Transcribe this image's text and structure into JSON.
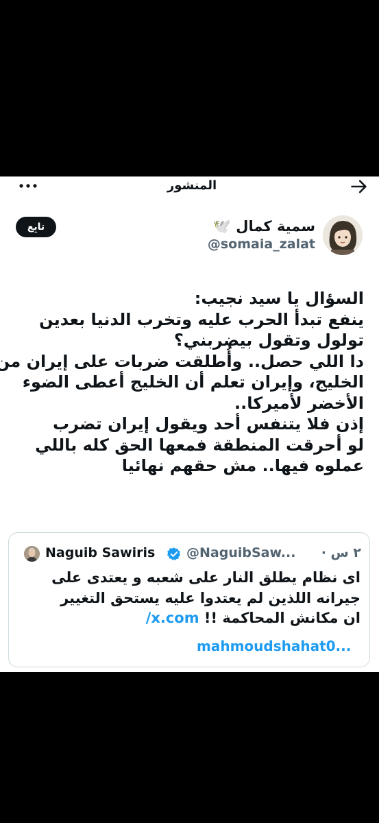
{
  "header": {
    "title": "المنشور",
    "back_icon": "arrow-right-icon",
    "more_icon": "more-horizontal-icon"
  },
  "author": {
    "name": "سمية كمال 🕊️",
    "handle": "@somaia_zalat",
    "follow_label": "تابِع"
  },
  "post": {
    "lines": [
      "السؤال يا سيد نجيب:",
      "ينفع تبدأ الحرب عليه وتخرب الدنيا بعدين",
      "تولول وتقول بيضربني؟",
      "دا اللي حصل.. وأُطلقت ضربات على إيران من",
      "الخليج، وإيران تعلم أن الخليج أعطى الضوء",
      "الأخضر لأميركا..",
      "إذن فلا يتنفس أحد ويقول إيران تضرب",
      "لو أحرقت المنطقة فمعها الحق كله باللي",
      "عملوه فيها.. مش حقهم نهائيا"
    ]
  },
  "quoted": {
    "name": "Naguib Sawiris",
    "handle": "@NaguibSaw...",
    "time": "٢ س ·",
    "lines": [
      "اى نظام يطلق النار على شعبه و يعتدى على",
      "جيرانه اللذين لم يعتدوا عليه يستحق التغيير",
      "ان مكانش المحاكمة !!"
    ],
    "link": "x.com/",
    "link2": "mahmoudshahat0..."
  },
  "colors": {
    "accent": "#1d9bf0",
    "text": "#0f1419",
    "muted": "#536471"
  }
}
